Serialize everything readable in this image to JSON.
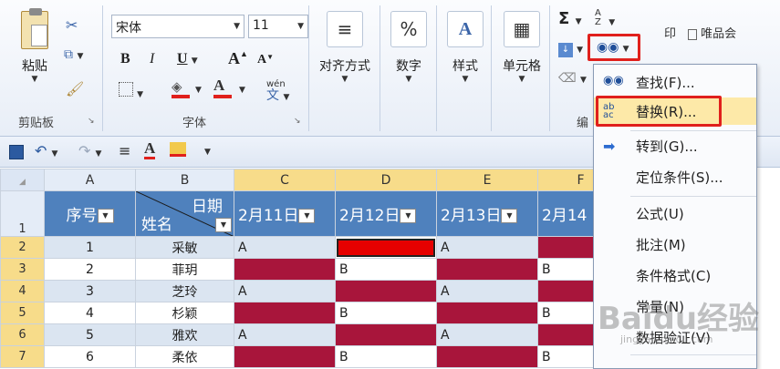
{
  "ribbon": {
    "clipboard": {
      "paste_label": "粘贴",
      "group_label": "剪贴板"
    },
    "font": {
      "font_name": "宋体",
      "font_size": "11",
      "group_label": "字体",
      "bold": "B",
      "italic": "I",
      "underline": "U",
      "grow": "A",
      "shrink": "A",
      "phonetic": "wén"
    },
    "alignment": {
      "label": "对齐方式"
    },
    "number": {
      "label": "数字",
      "icon_text": "%"
    },
    "styles": {
      "label": "样式"
    },
    "cells": {
      "label": "单元格"
    },
    "editing": {
      "sigma": "Σ",
      "sort": "A Z",
      "group_label_partial": "编"
    },
    "tabs_right": {
      "tab1": "印",
      "tab2": "唯品会"
    }
  },
  "sheet": {
    "columns": [
      "A",
      "B",
      "C",
      "D",
      "E",
      "F"
    ],
    "header_row": {
      "row_num": "1",
      "a": "序号",
      "b_top": "日期",
      "b_bottom": "姓名",
      "c": "2月11日",
      "d": "2月12日",
      "e": "2月13日",
      "f": "2月14"
    },
    "rows": [
      {
        "num": "2",
        "a": "1",
        "b": "采敏",
        "c": "A",
        "d": "",
        "e": "A",
        "f": ""
      },
      {
        "num": "3",
        "a": "2",
        "b": "菲玥",
        "c": "",
        "d": "B",
        "e": "",
        "f": "B"
      },
      {
        "num": "4",
        "a": "3",
        "b": "芝玲",
        "c": "A",
        "d": "",
        "e": "A",
        "f": ""
      },
      {
        "num": "5",
        "a": "4",
        "b": "杉颖",
        "c": "",
        "d": "B",
        "e": "",
        "f": "B"
      },
      {
        "num": "6",
        "a": "5",
        "b": "雅欢",
        "c": "A",
        "d": "",
        "e": "A",
        "f": ""
      },
      {
        "num": "7",
        "a": "6",
        "b": "柔依",
        "c": "",
        "d": "B",
        "e": "",
        "f": "B"
      }
    ]
  },
  "menu": {
    "items": [
      {
        "label": "查找(F)..."
      },
      {
        "label": "替换(R)..."
      },
      {
        "label": "转到(G)..."
      },
      {
        "label": "定位条件(S)..."
      },
      {
        "label": "公式(U)"
      },
      {
        "label": "批注(M)"
      },
      {
        "label": "条件格式(C)"
      },
      {
        "label": "常量(N)"
      },
      {
        "label": "数据验证(V)"
      }
    ]
  },
  "watermark": {
    "text": "Baidu经验",
    "sub": "jingyan.baidu.com"
  },
  "colors": {
    "accent_red": "#e0201c",
    "crimson_fill": "#a8153b",
    "header_blue": "#4f81bd",
    "selected_col": "#f7dc8a"
  }
}
